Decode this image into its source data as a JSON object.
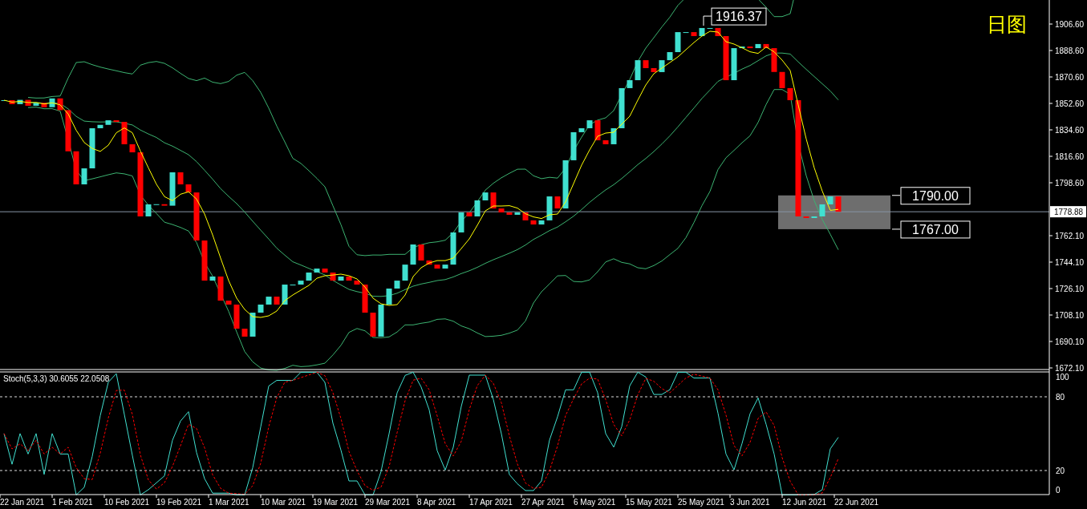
{
  "price_chart": {
    "title": "日图",
    "price_axis": [
      "1906.60",
      "1888.60",
      "1870.60",
      "1852.60",
      "1834.60",
      "1816.60",
      "1798.60",
      "1762.10",
      "1744.10",
      "1726.10",
      "1708.10",
      "1690.10",
      "1672.10"
    ],
    "current_price": "1778.88",
    "high_label": "1916.37",
    "zone_labels": [
      "1790.00",
      "1767.00"
    ],
    "date_axis": [
      "22 Jan 2021",
      "1 Feb 2021",
      "10 Feb 2021",
      "19 Feb 2021",
      "1 Mar 2021",
      "10 Mar 2021",
      "19 Mar 2021",
      "29 Mar 2021",
      "8 Apr 2021",
      "17 Apr 2021",
      "27 Apr 2021",
      "6 May 2021",
      "15 May 2021",
      "25 May 2021",
      "3 Jun 2021",
      "12 Jun 2021",
      "22 Jun 2021"
    ]
  },
  "oscillator": {
    "title": "Stoch(5,3,3) 30.6055 22.0508",
    "levels": [
      {
        "value": "100",
        "kind": "limit"
      },
      {
        "value": "80",
        "kind": "level"
      },
      {
        "value": "20",
        "kind": "level"
      },
      {
        "value": "0",
        "kind": "limit"
      }
    ]
  }
}
